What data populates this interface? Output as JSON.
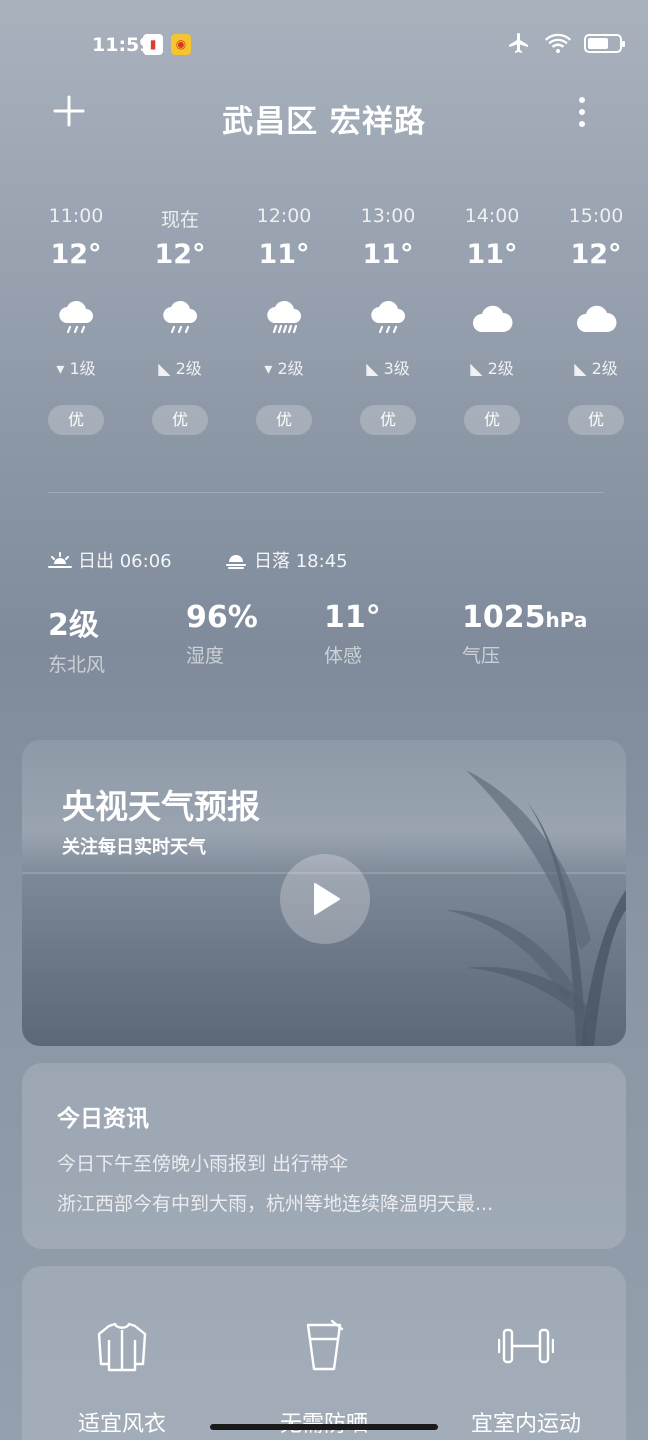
{
  "status_bar": {
    "time": "11:59",
    "notif1": "▮",
    "notif2": "◉"
  },
  "header": {
    "title": "武昌区 宏祥路"
  },
  "hourly": [
    {
      "time": "11:00",
      "temp": "12°",
      "icon": "rain-light-icon",
      "wind": "1级",
      "aqi": "优"
    },
    {
      "time": "现在",
      "temp": "12°",
      "icon": "rain-light-icon",
      "wind": "2级",
      "aqi": "优"
    },
    {
      "time": "12:00",
      "temp": "11°",
      "icon": "rain-moderate-icon",
      "wind": "2级",
      "aqi": "优"
    },
    {
      "time": "13:00",
      "temp": "11°",
      "icon": "rain-light-icon",
      "wind": "3级",
      "aqi": "优"
    },
    {
      "time": "14:00",
      "temp": "11°",
      "icon": "cloud-icon",
      "wind": "2级",
      "aqi": "优"
    },
    {
      "time": "15:00",
      "temp": "12°",
      "icon": "cloud-icon",
      "wind": "2级",
      "aqi": "优"
    }
  ],
  "sun": {
    "sunrise": "日出 06:06",
    "sunset": "日落 18:45"
  },
  "metrics": [
    {
      "value": "2级",
      "unit": "",
      "label": "东北风"
    },
    {
      "value": "96%",
      "unit": "",
      "label": "湿度"
    },
    {
      "value": "11°",
      "unit": "",
      "label": "体感"
    },
    {
      "value": "1025",
      "unit": "hPa",
      "label": "气压"
    }
  ],
  "video": {
    "title": "央视天气预报",
    "subtitle": "关注每日实时天气"
  },
  "news": {
    "title": "今日资讯",
    "items": [
      "今日下午至傍晚小雨报到 出行带伞",
      "浙江西部今有中到大雨，杭州等地连续降温明天最..."
    ]
  },
  "life": [
    {
      "label": "适宜风衣",
      "icon": "jacket-icon"
    },
    {
      "label": "无需防晒",
      "icon": "sunscreen-icon"
    },
    {
      "label": "宜室内运动",
      "icon": "dumbbell-icon"
    }
  ],
  "colors": {
    "background_top": "#a9b1bd",
    "background_mid": "#7f8b9b",
    "card": "rgba(255,255,255,0.14)"
  }
}
